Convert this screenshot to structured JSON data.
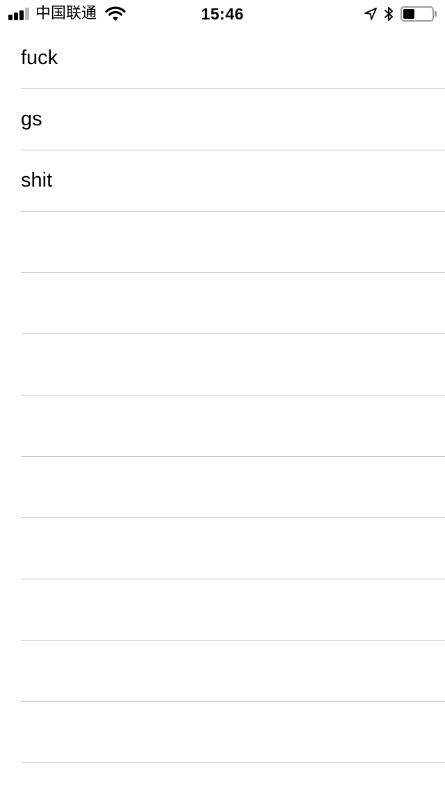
{
  "status_bar": {
    "signal_bars_filled": 3,
    "signal_bars_total": 4,
    "carrier": "中国联通",
    "time": "15:46",
    "battery_level_fraction": 0.4,
    "icons": [
      "signal-icon",
      "wifi-icon",
      "location-arrow-icon",
      "bluetooth-icon",
      "battery-icon"
    ]
  },
  "table": {
    "rows": [
      {
        "label": "fuck"
      },
      {
        "label": "gs"
      },
      {
        "label": "shit"
      },
      {
        "label": ""
      },
      {
        "label": ""
      },
      {
        "label": ""
      },
      {
        "label": ""
      },
      {
        "label": ""
      },
      {
        "label": ""
      },
      {
        "label": ""
      },
      {
        "label": ""
      },
      {
        "label": ""
      }
    ]
  },
  "colors": {
    "background": "#ffffff",
    "text": "#000000",
    "separator": "#c8c7cc",
    "status_icon_gray": "#9a9a9a"
  }
}
